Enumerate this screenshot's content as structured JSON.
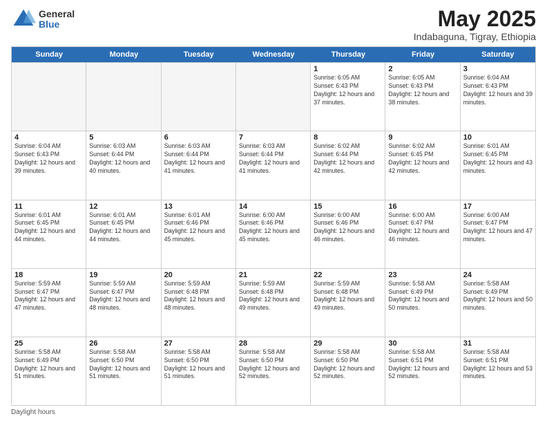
{
  "header": {
    "logo": {
      "general": "General",
      "blue": "Blue"
    },
    "title": "May 2025",
    "location": "Indabaguna, Tigray, Ethiopia"
  },
  "weekdays": [
    "Sunday",
    "Monday",
    "Tuesday",
    "Wednesday",
    "Thursday",
    "Friday",
    "Saturday"
  ],
  "rows": [
    [
      {
        "day": "",
        "info": ""
      },
      {
        "day": "",
        "info": ""
      },
      {
        "day": "",
        "info": ""
      },
      {
        "day": "",
        "info": ""
      },
      {
        "day": "1",
        "info": "Sunrise: 6:05 AM\nSunset: 6:43 PM\nDaylight: 12 hours and 37 minutes."
      },
      {
        "day": "2",
        "info": "Sunrise: 6:05 AM\nSunset: 6:43 PM\nDaylight: 12 hours and 38 minutes."
      },
      {
        "day": "3",
        "info": "Sunrise: 6:04 AM\nSunset: 6:43 PM\nDaylight: 12 hours and 39 minutes."
      }
    ],
    [
      {
        "day": "4",
        "info": "Sunrise: 6:04 AM\nSunset: 6:43 PM\nDaylight: 12 hours and 39 minutes."
      },
      {
        "day": "5",
        "info": "Sunrise: 6:03 AM\nSunset: 6:44 PM\nDaylight: 12 hours and 40 minutes."
      },
      {
        "day": "6",
        "info": "Sunrise: 6:03 AM\nSunset: 6:44 PM\nDaylight: 12 hours and 41 minutes."
      },
      {
        "day": "7",
        "info": "Sunrise: 6:03 AM\nSunset: 6:44 PM\nDaylight: 12 hours and 41 minutes."
      },
      {
        "day": "8",
        "info": "Sunrise: 6:02 AM\nSunset: 6:44 PM\nDaylight: 12 hours and 42 minutes."
      },
      {
        "day": "9",
        "info": "Sunrise: 6:02 AM\nSunset: 6:45 PM\nDaylight: 12 hours and 42 minutes."
      },
      {
        "day": "10",
        "info": "Sunrise: 6:01 AM\nSunset: 6:45 PM\nDaylight: 12 hours and 43 minutes."
      }
    ],
    [
      {
        "day": "11",
        "info": "Sunrise: 6:01 AM\nSunset: 6:45 PM\nDaylight: 12 hours and 44 minutes."
      },
      {
        "day": "12",
        "info": "Sunrise: 6:01 AM\nSunset: 6:45 PM\nDaylight: 12 hours and 44 minutes."
      },
      {
        "day": "13",
        "info": "Sunrise: 6:01 AM\nSunset: 6:46 PM\nDaylight: 12 hours and 45 minutes."
      },
      {
        "day": "14",
        "info": "Sunrise: 6:00 AM\nSunset: 6:46 PM\nDaylight: 12 hours and 45 minutes."
      },
      {
        "day": "15",
        "info": "Sunrise: 6:00 AM\nSunset: 6:46 PM\nDaylight: 12 hours and 46 minutes."
      },
      {
        "day": "16",
        "info": "Sunrise: 6:00 AM\nSunset: 6:47 PM\nDaylight: 12 hours and 46 minutes."
      },
      {
        "day": "17",
        "info": "Sunrise: 6:00 AM\nSunset: 6:47 PM\nDaylight: 12 hours and 47 minutes."
      }
    ],
    [
      {
        "day": "18",
        "info": "Sunrise: 5:59 AM\nSunset: 6:47 PM\nDaylight: 12 hours and 47 minutes."
      },
      {
        "day": "19",
        "info": "Sunrise: 5:59 AM\nSunset: 6:47 PM\nDaylight: 12 hours and 48 minutes."
      },
      {
        "day": "20",
        "info": "Sunrise: 5:59 AM\nSunset: 6:48 PM\nDaylight: 12 hours and 48 minutes."
      },
      {
        "day": "21",
        "info": "Sunrise: 5:59 AM\nSunset: 6:48 PM\nDaylight: 12 hours and 49 minutes."
      },
      {
        "day": "22",
        "info": "Sunrise: 5:59 AM\nSunset: 6:48 PM\nDaylight: 12 hours and 49 minutes."
      },
      {
        "day": "23",
        "info": "Sunrise: 5:58 AM\nSunset: 6:49 PM\nDaylight: 12 hours and 50 minutes."
      },
      {
        "day": "24",
        "info": "Sunrise: 5:58 AM\nSunset: 6:49 PM\nDaylight: 12 hours and 50 minutes."
      }
    ],
    [
      {
        "day": "25",
        "info": "Sunrise: 5:58 AM\nSunset: 6:49 PM\nDaylight: 12 hours and 51 minutes."
      },
      {
        "day": "26",
        "info": "Sunrise: 5:58 AM\nSunset: 6:50 PM\nDaylight: 12 hours and 51 minutes."
      },
      {
        "day": "27",
        "info": "Sunrise: 5:58 AM\nSunset: 6:50 PM\nDaylight: 12 hours and 51 minutes."
      },
      {
        "day": "28",
        "info": "Sunrise: 5:58 AM\nSunset: 6:50 PM\nDaylight: 12 hours and 52 minutes."
      },
      {
        "day": "29",
        "info": "Sunrise: 5:58 AM\nSunset: 6:50 PM\nDaylight: 12 hours and 52 minutes."
      },
      {
        "day": "30",
        "info": "Sunrise: 5:58 AM\nSunset: 6:51 PM\nDaylight: 12 hours and 52 minutes."
      },
      {
        "day": "31",
        "info": "Sunrise: 5:58 AM\nSunset: 6:51 PM\nDaylight: 12 hours and 53 minutes."
      }
    ]
  ],
  "footer": {
    "note": "Daylight hours"
  }
}
